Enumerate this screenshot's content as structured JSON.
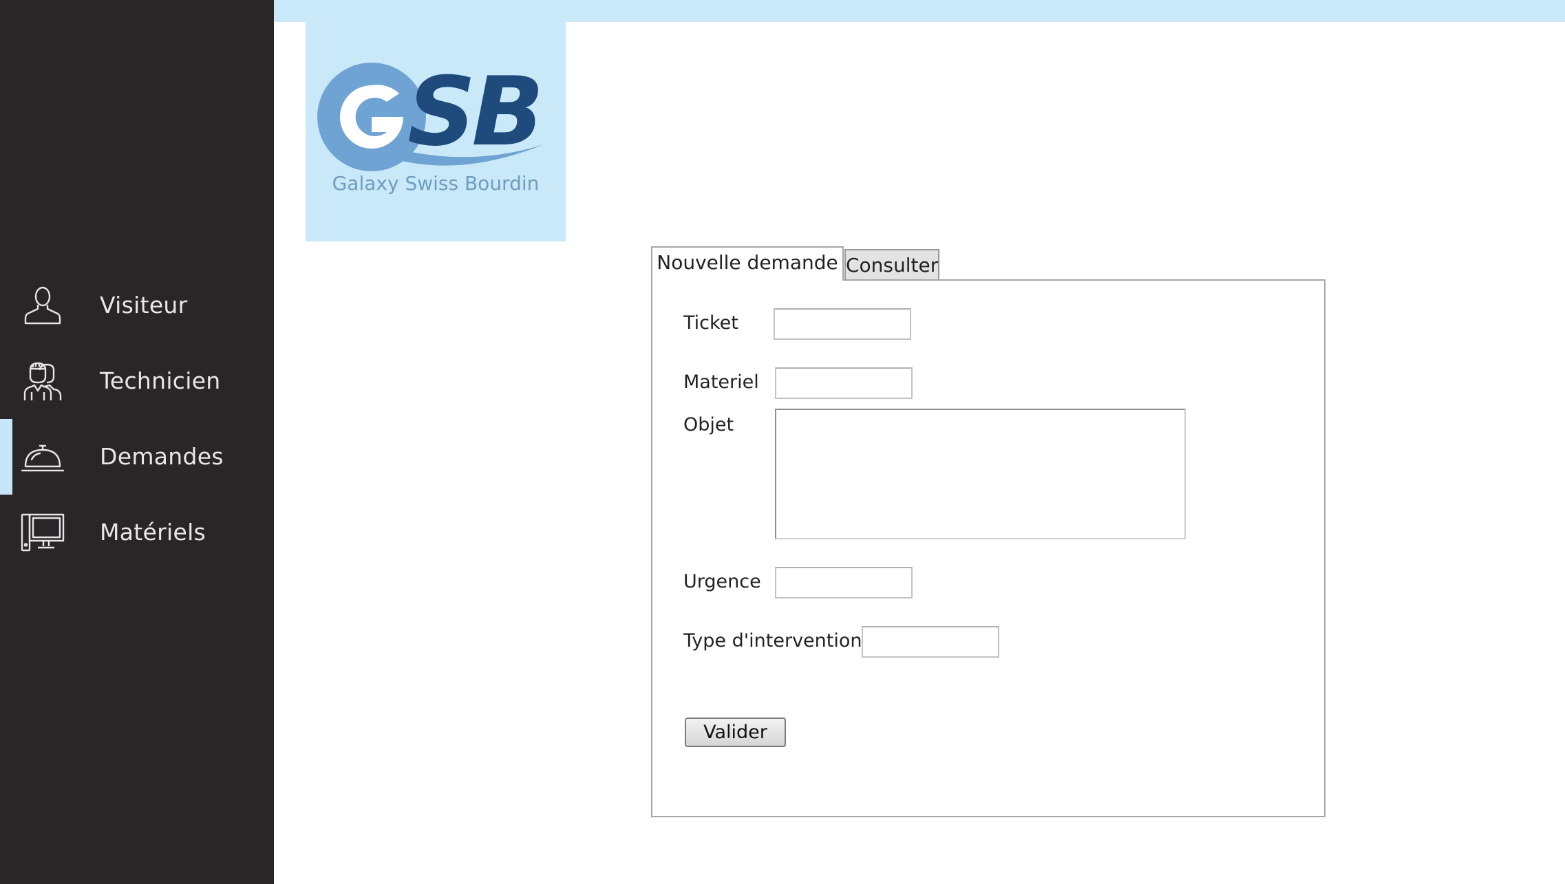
{
  "logo": {
    "letters": "GSB",
    "subtitle": "Galaxy Swiss Bourdin"
  },
  "sidebar": {
    "items": [
      {
        "label": "Visiteur",
        "icon": "user-icon",
        "active": false
      },
      {
        "label": "Technicien",
        "icon": "technicians-icon",
        "active": false
      },
      {
        "label": "Demandes",
        "icon": "service-bell-icon",
        "active": true
      },
      {
        "label": "Matériels",
        "icon": "computer-icon",
        "active": false
      }
    ]
  },
  "tabs": [
    {
      "label": "Nouvelle demande",
      "active": true
    },
    {
      "label": "Consulter",
      "active": false
    }
  ],
  "form": {
    "ticket_label": "Ticket",
    "ticket_value": "",
    "materiel_label": "Materiel",
    "materiel_value": "",
    "objet_label": "Objet",
    "objet_value": "",
    "urgence_label": "Urgence",
    "urgence_value": "",
    "type_label": "Type d'intervention",
    "type_value": "",
    "submit_label": "Valider"
  },
  "colors": {
    "sidebar_bg": "#282627",
    "accent_light_blue": "#c9e9f9",
    "logo_light": "#6fa3d3",
    "logo_dark": "#1f4a7c"
  }
}
